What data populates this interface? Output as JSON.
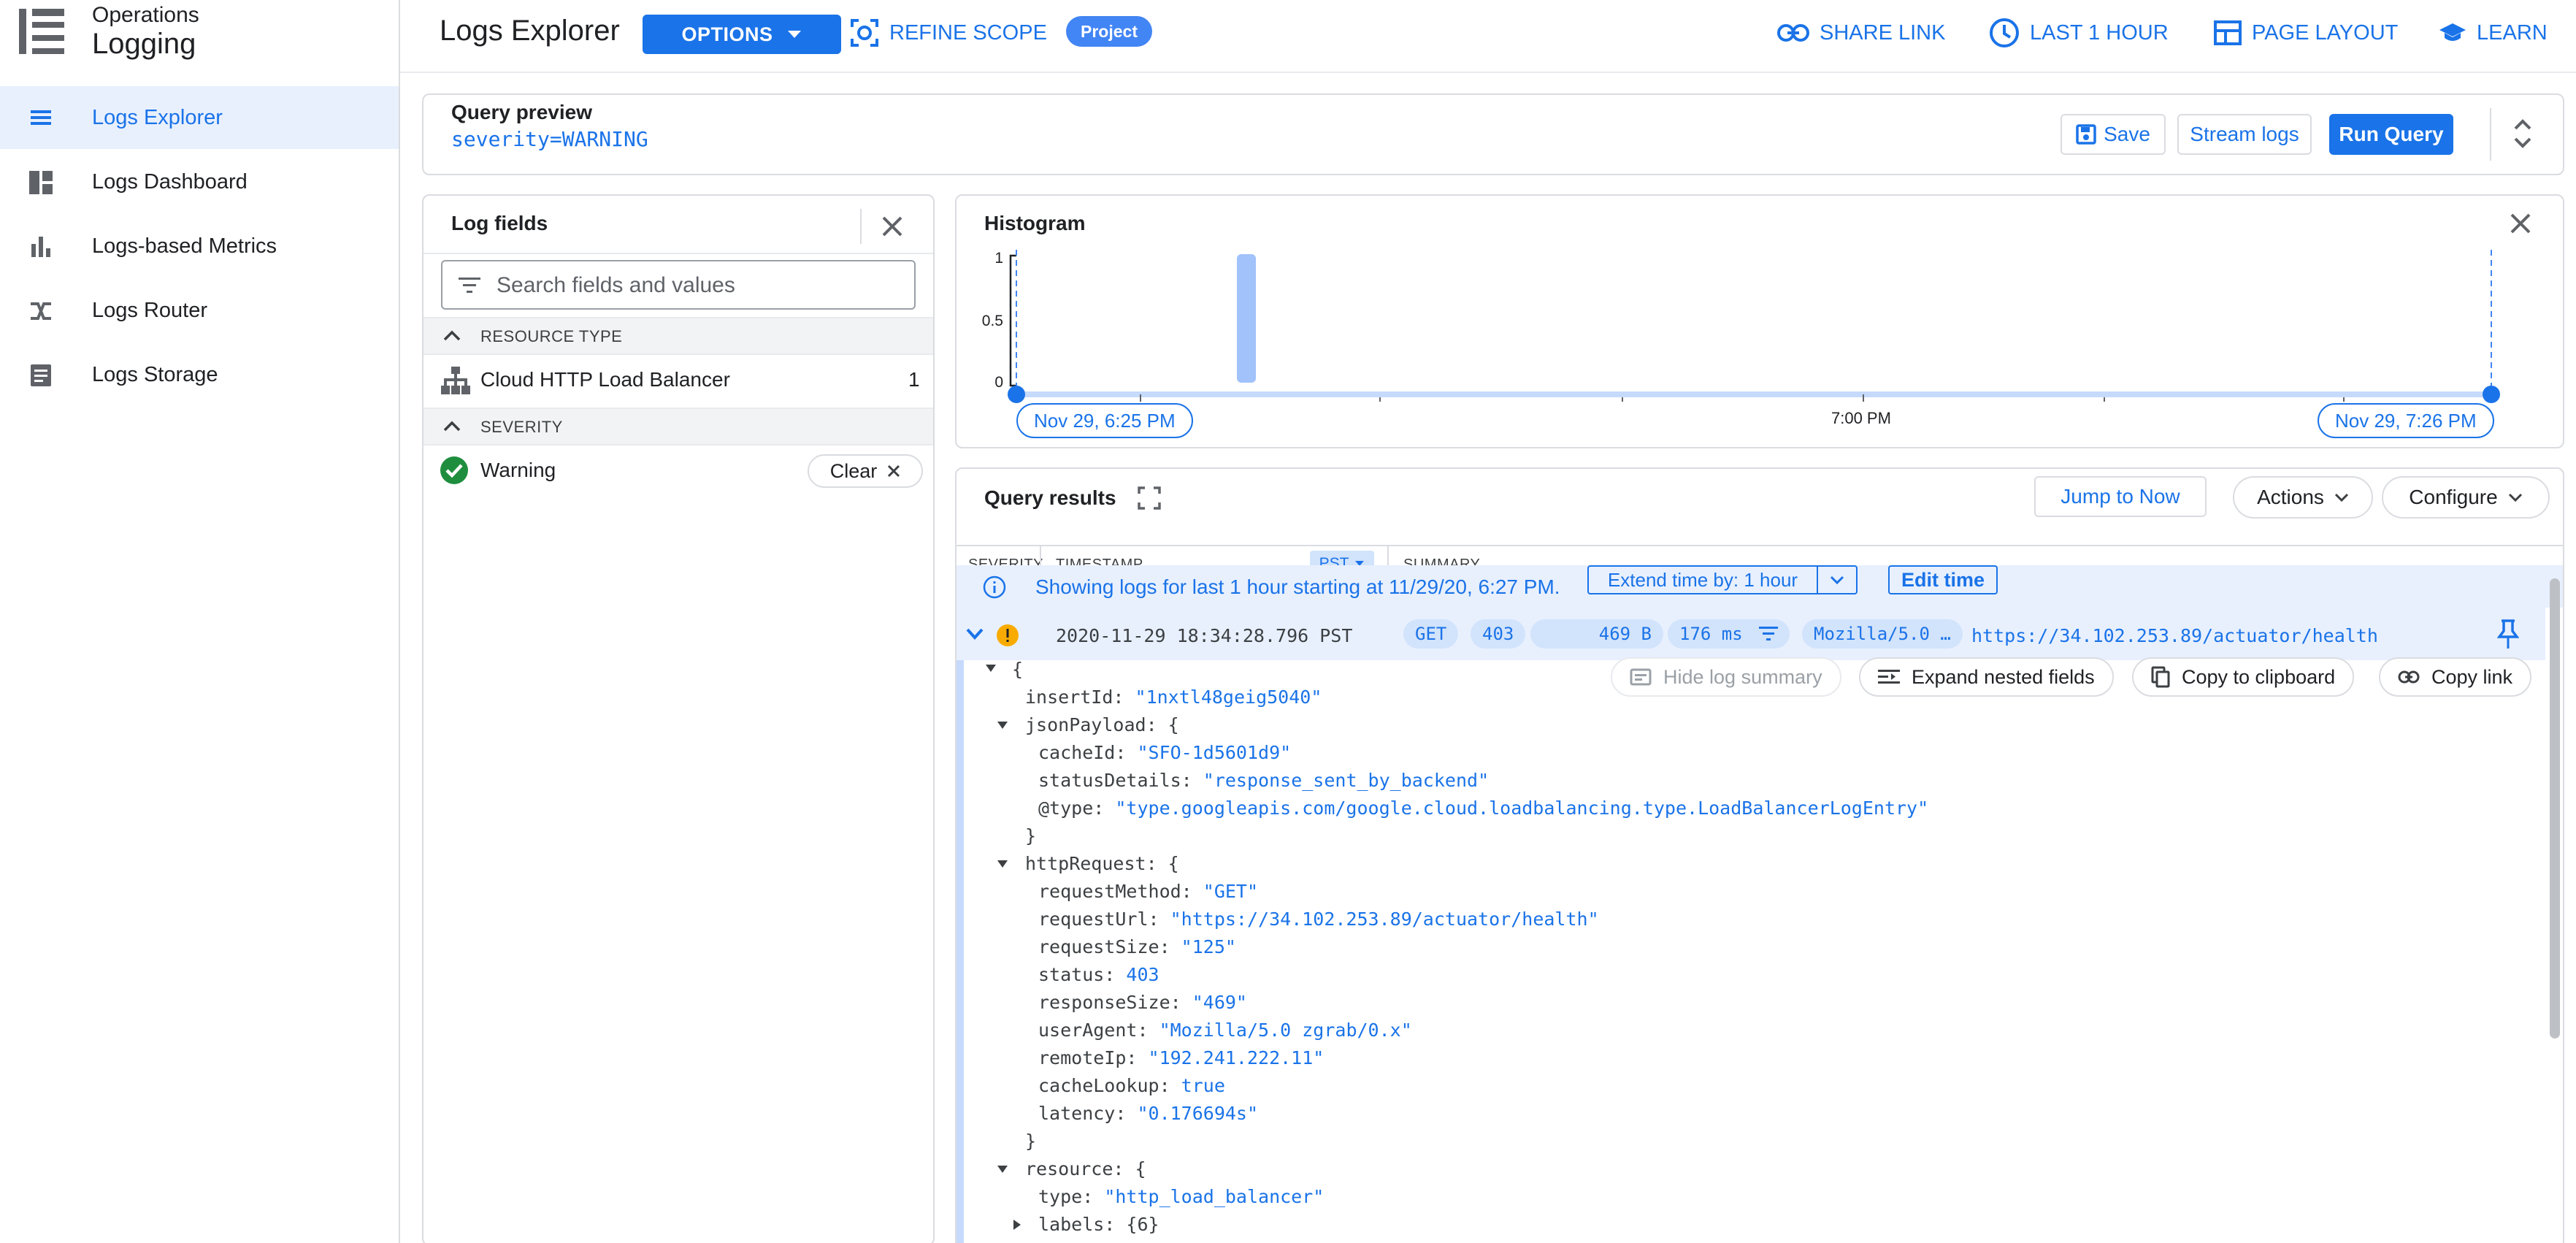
{
  "app": {
    "product_line": "Operations",
    "product_name": "Logging"
  },
  "sidebar": {
    "items": [
      {
        "label": "Logs Explorer",
        "icon": "list-icon",
        "active": true
      },
      {
        "label": "Logs Dashboard",
        "icon": "dashboard-icon",
        "active": false
      },
      {
        "label": "Logs-based Metrics",
        "icon": "bar-chart-icon",
        "active": false
      },
      {
        "label": "Logs Router",
        "icon": "router-icon",
        "active": false
      },
      {
        "label": "Logs Storage",
        "icon": "storage-icon",
        "active": false
      }
    ]
  },
  "header": {
    "title": "Logs Explorer",
    "options_label": "OPTIONS",
    "refine_scope_label": "REFINE SCOPE",
    "scope_badge": "Project",
    "share_link_label": "SHARE LINK",
    "time_range_label": "LAST 1 HOUR",
    "page_layout_label": "PAGE LAYOUT",
    "learn_label": "LEARN"
  },
  "query_preview": {
    "label": "Query preview",
    "query": "severity=WARNING",
    "save_label": "Save",
    "stream_label": "Stream logs",
    "run_label": "Run Query"
  },
  "log_fields": {
    "title": "Log fields",
    "search_placeholder": "Search fields and values",
    "sections": [
      {
        "name": "RESOURCE TYPE",
        "rows": [
          {
            "label": "Cloud HTTP Load Balancer",
            "count": "1"
          }
        ]
      },
      {
        "name": "SEVERITY",
        "rows": [
          {
            "label": "Warning",
            "action": "Clear"
          }
        ]
      }
    ]
  },
  "histogram": {
    "title": "Histogram",
    "y_ticks": [
      "1",
      "0.5",
      "0"
    ],
    "x_tick_label": "7:00 PM",
    "start_label": "Nov 29, 6:25 PM",
    "end_label": "Nov 29, 7:26 PM"
  },
  "results": {
    "title": "Query results",
    "jump_label": "Jump to Now",
    "actions_label": "Actions",
    "configure_label": "Configure",
    "columns": {
      "severity": "SEVERITY",
      "timestamp": "TIMESTAMP",
      "timezone": "PST",
      "summary": "SUMMARY"
    },
    "info_text": "Showing logs for last 1 hour starting at 11/29/20, 6:27 PM.",
    "extend_label": "Extend time by: 1 hour",
    "edit_time_label": "Edit time",
    "row": {
      "timestamp": "2020-11-29 18:34:28.796 PST",
      "method": "GET",
      "status": "403",
      "size": "469 B",
      "latency": "176 ms",
      "user_agent": "Mozilla/5.0 …",
      "url": "https://34.102.253.89/actuator/health"
    },
    "actions": {
      "hide_summary": "Hide log summary",
      "expand_nested": "Expand nested fields",
      "copy_clipboard": "Copy to clipboard",
      "copy_link": "Copy link"
    },
    "json_lines": [
      {
        "k": "{",
        "v": ""
      },
      {
        "k": "insertId: ",
        "v": "\"1nxtl48geig5040\""
      },
      {
        "k": "jsonPayload: {",
        "v": ""
      },
      {
        "k": "cacheId: ",
        "v": "\"SFO-1d5601d9\""
      },
      {
        "k": "statusDetails: ",
        "v": "\"response_sent_by_backend\""
      },
      {
        "k": "@type: ",
        "v": "\"type.googleapis.com/google.cloud.loadbalancing.type.LoadBalancerLogEntry\""
      },
      {
        "k": "}",
        "v": ""
      },
      {
        "k": "httpRequest: {",
        "v": ""
      },
      {
        "k": "requestMethod: ",
        "v": "\"GET\""
      },
      {
        "k": "requestUrl: ",
        "v": "\"https://34.102.253.89/actuator/health\""
      },
      {
        "k": "requestSize: ",
        "v": "\"125\""
      },
      {
        "k": "status: ",
        "v": "403"
      },
      {
        "k": "responseSize: ",
        "v": "\"469\""
      },
      {
        "k": "userAgent: ",
        "v": "\"Mozilla/5.0 zgrab/0.x\""
      },
      {
        "k": "remoteIp: ",
        "v": "\"192.241.222.11\""
      },
      {
        "k": "cacheLookup: ",
        "v": "true"
      },
      {
        "k": "latency: ",
        "v": "\"0.176694s\""
      },
      {
        "k": "}",
        "v": ""
      },
      {
        "k": "resource: {",
        "v": ""
      },
      {
        "k": "type: ",
        "v": "\"http_load_balancer\""
      },
      {
        "k": "labels: {6}",
        "v": ""
      }
    ]
  },
  "colors": {
    "accent": "#1a73e8",
    "warning": "#f9ab00",
    "success": "#1e8e3e",
    "selected_bg": "#e8f0fe"
  }
}
